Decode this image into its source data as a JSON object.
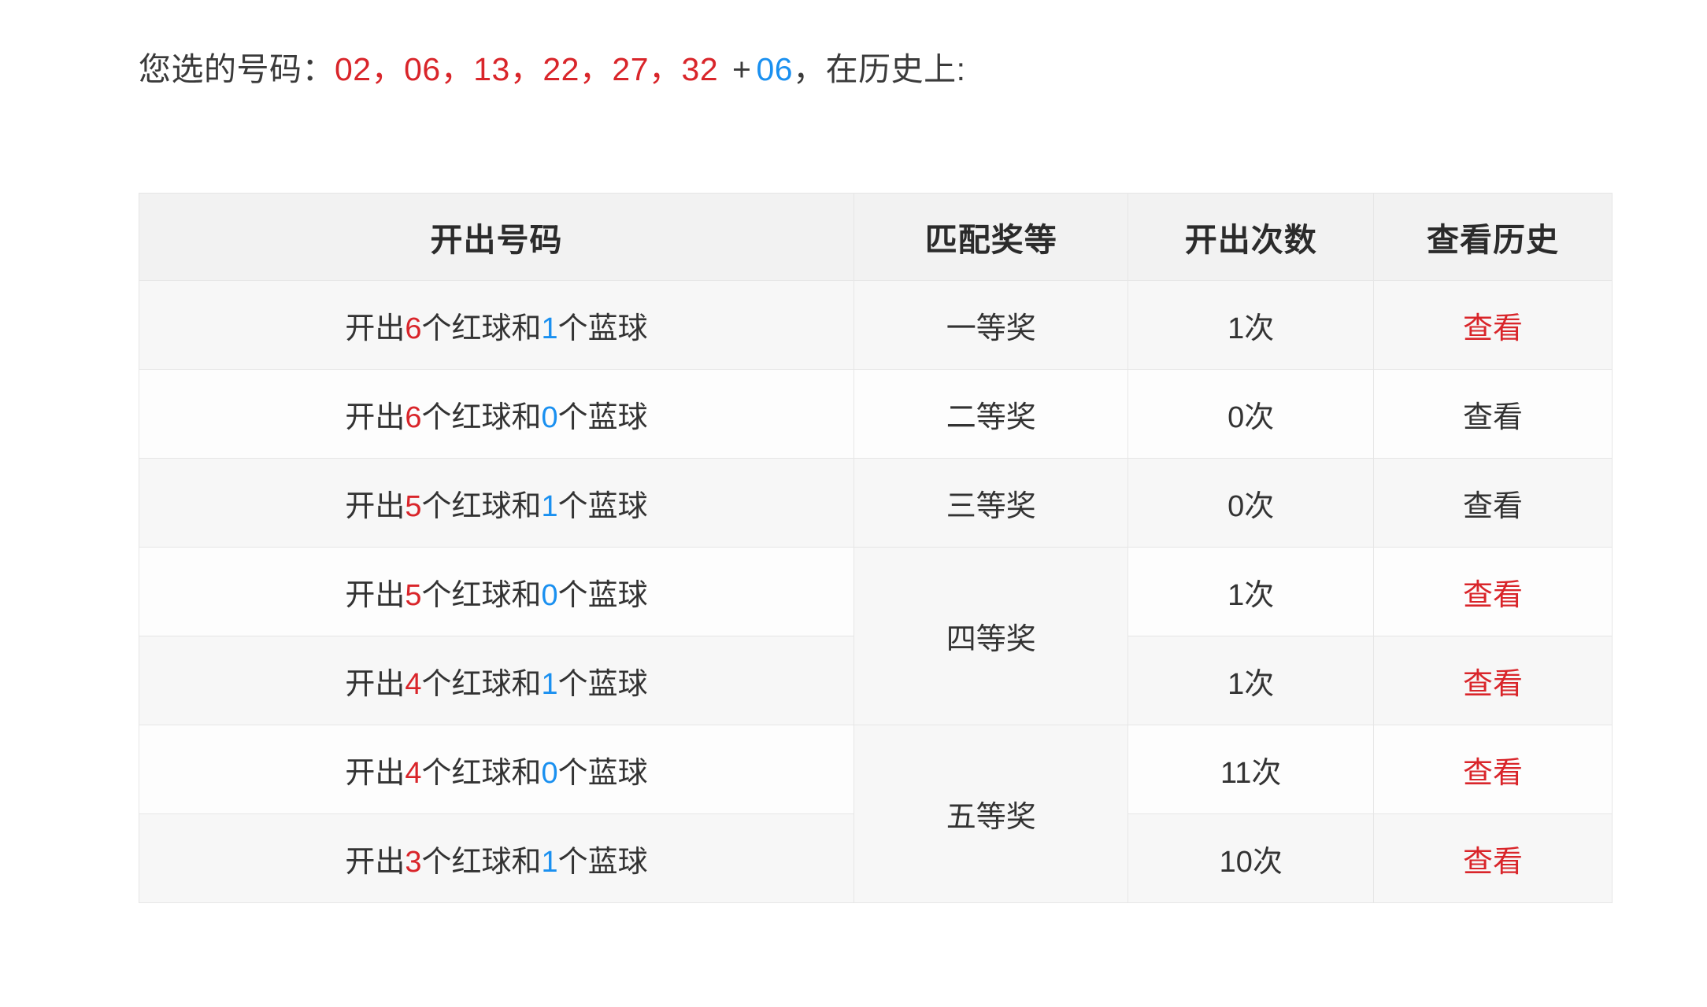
{
  "summary": {
    "label_prefix": "您选的号码：",
    "red_numbers": [
      "02",
      "06",
      "13",
      "22",
      "27",
      "32"
    ],
    "plus": "+",
    "blue_number": "06",
    "label_suffix": "，在历史上:",
    "comma": "，"
  },
  "colors": {
    "red": "#d9252a",
    "blue": "#1a90f0",
    "text": "#333333",
    "header_bg": "#f2f2f2",
    "row_bg_odd": "#f7f7f7",
    "row_bg_even": "#fdfdfd",
    "border": "#e6e6e6"
  },
  "table": {
    "headers": [
      "开出号码",
      "匹配奖等",
      "开出次数",
      "查看历史"
    ],
    "rows": [
      {
        "desc_prefix": "开出",
        "red_count": "6",
        "desc_mid": "个红球和",
        "blue_count": "1",
        "desc_suffix": "个蓝球",
        "prize": "一等奖",
        "prize_rowspan": 1,
        "count": "1次",
        "view": "查看",
        "view_active": true
      },
      {
        "desc_prefix": "开出",
        "red_count": "6",
        "desc_mid": "个红球和",
        "blue_count": "0",
        "desc_suffix": "个蓝球",
        "prize": "二等奖",
        "prize_rowspan": 1,
        "count": "0次",
        "view": "查看",
        "view_active": false
      },
      {
        "desc_prefix": "开出",
        "red_count": "5",
        "desc_mid": "个红球和",
        "blue_count": "1",
        "desc_suffix": "个蓝球",
        "prize": "三等奖",
        "prize_rowspan": 1,
        "count": "0次",
        "view": "查看",
        "view_active": false
      },
      {
        "desc_prefix": "开出",
        "red_count": "5",
        "desc_mid": "个红球和",
        "blue_count": "0",
        "desc_suffix": "个蓝球",
        "prize": "四等奖",
        "prize_rowspan": 2,
        "count": "1次",
        "view": "查看",
        "view_active": true
      },
      {
        "desc_prefix": "开出",
        "red_count": "4",
        "desc_mid": "个红球和",
        "blue_count": "1",
        "desc_suffix": "个蓝球",
        "prize": null,
        "prize_rowspan": 0,
        "count": "1次",
        "view": "查看",
        "view_active": true
      },
      {
        "desc_prefix": "开出",
        "red_count": "4",
        "desc_mid": "个红球和",
        "blue_count": "0",
        "desc_suffix": "个蓝球",
        "prize": "五等奖",
        "prize_rowspan": 2,
        "count": "11次",
        "view": "查看",
        "view_active": true
      },
      {
        "desc_prefix": "开出",
        "red_count": "3",
        "desc_mid": "个红球和",
        "blue_count": "1",
        "desc_suffix": "个蓝球",
        "prize": null,
        "prize_rowspan": 0,
        "count": "10次",
        "view": "查看",
        "view_active": true
      }
    ]
  }
}
